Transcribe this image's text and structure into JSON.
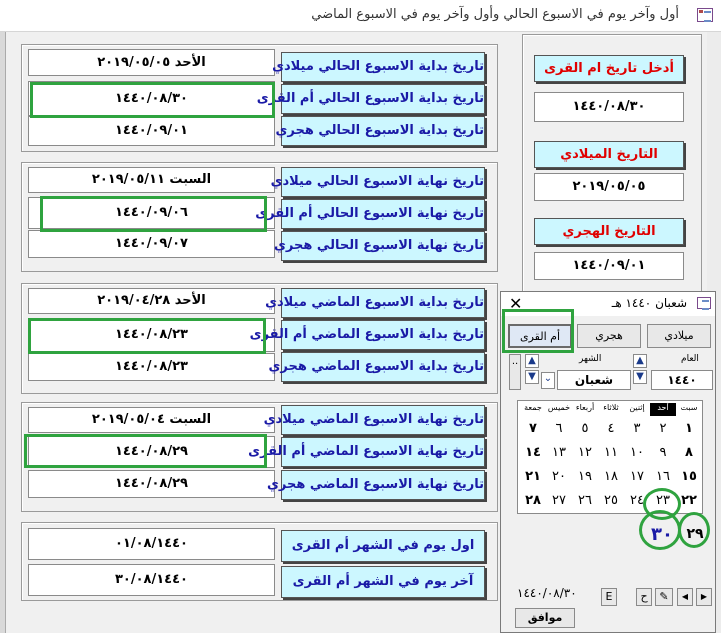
{
  "window": {
    "title": "أول وآخر يوم في الاسبوع الحالي وأول وآخر يوم في الاسبوع الماضي"
  },
  "inputs": {
    "umm_label": "أدخل تاريخ ام القرى",
    "umm_value": "١٤٤٠/٠٨/٣٠",
    "greg_label": "التاريخ الميلادي",
    "greg_value": "٢٠١٩/٠٥/٠٥",
    "hijri_label": "التاريخ الهجري",
    "hijri_value": "١٤٤٠/٠٩/٠١"
  },
  "groups": [
    {
      "rows": [
        {
          "label": "تاريخ بداية الاسبوع الحالي ميلادي",
          "value": "الأحد   ٢٠١٩/٠٥/٠٥"
        },
        {
          "label": "تاريخ بداية الاسبوع الحالي أم القرى",
          "value": "١٤٤٠/٠٨/٣٠"
        },
        {
          "label": "تاريخ بداية الاسبوع الحالي هجري",
          "value": "١٤٤٠/٠٩/٠١"
        }
      ]
    },
    {
      "rows": [
        {
          "label": "تاريخ نهاية الاسبوع الحالي ميلادي",
          "value": "السبت  ٢٠١٩/٠٥/١١"
        },
        {
          "label": "تاريخ نهاية الاسبوع الحالي أم القرى",
          "value": "١٤٤٠/٠٩/٠٦"
        },
        {
          "label": "تاريخ نهاية الاسبوع الحالي هجري",
          "value": "١٤٤٠/٠٩/٠٧"
        }
      ]
    },
    {
      "rows": [
        {
          "label": "تاريخ بداية الاسبوع الماضي ميلادي",
          "value": "الأحد   ٢٠١٩/٠٤/٢٨"
        },
        {
          "label": "تاريخ بداية الاسبوع الماضي أم القرى",
          "value": "١٤٤٠/٠٨/٢٣"
        },
        {
          "label": "تاريخ بداية الاسبوع الماضي هجري",
          "value": "١٤٤٠/٠٨/٢٣"
        }
      ]
    },
    {
      "rows": [
        {
          "label": "تاريخ نهاية الاسبوع الماضي ميلادي",
          "value": "السبت  ٢٠١٩/٠٥/٠٤"
        },
        {
          "label": "تاريخ نهاية الاسبوع الماضي أم القرى",
          "value": "١٤٤٠/٠٨/٢٩"
        },
        {
          "label": "تاريخ نهاية الاسبوع الماضي هجري",
          "value": "١٤٤٠/٠٨/٢٩"
        }
      ]
    },
    {
      "rows": [
        {
          "label": "اول يوم في الشهر أم القرى",
          "value": "٠١/٠٨/١٤٤٠"
        },
        {
          "label": "آخر يوم في الشهر أم القرى",
          "value": "٣٠/٠٨/١٤٤٠"
        }
      ]
    }
  ],
  "calendar": {
    "title": "شعبان ١٤٤٠ هـ",
    "modes": [
      "ميلادي",
      "هجري",
      "أم القرى"
    ],
    "year_label": "العام",
    "year_value": "١٤٤٠",
    "month_label": "الشهر",
    "month_value": "شعبان",
    "spin_dots": "..",
    "weekdays": [
      "سبت",
      "أحد",
      "إثنين",
      "ثلاثاء",
      "أربعاء",
      "خميس",
      "جمعة"
    ],
    "weeks": [
      [
        "١",
        "٢",
        "٣",
        "٤",
        "٥",
        "٦",
        "٧"
      ],
      [
        "٨",
        "٩",
        "١٠",
        "١١",
        "١٢",
        "١٣",
        "١٤"
      ],
      [
        "١٥",
        "١٦",
        "١٧",
        "١٨",
        "١٩",
        "٢٠",
        "٢١"
      ],
      [
        "٢٢",
        "٢٣",
        "٢٤",
        "٢٥",
        "٢٦",
        "٢٧",
        "٢٨"
      ],
      [
        "٢٩",
        "٣٠"
      ]
    ],
    "selected_date": "١٤٤٠/٠٨/٣٠",
    "ok_label": "موافق",
    "e_label": "E",
    "h_label": "ح",
    "nav": [
      "◀",
      "▶"
    ]
  }
}
